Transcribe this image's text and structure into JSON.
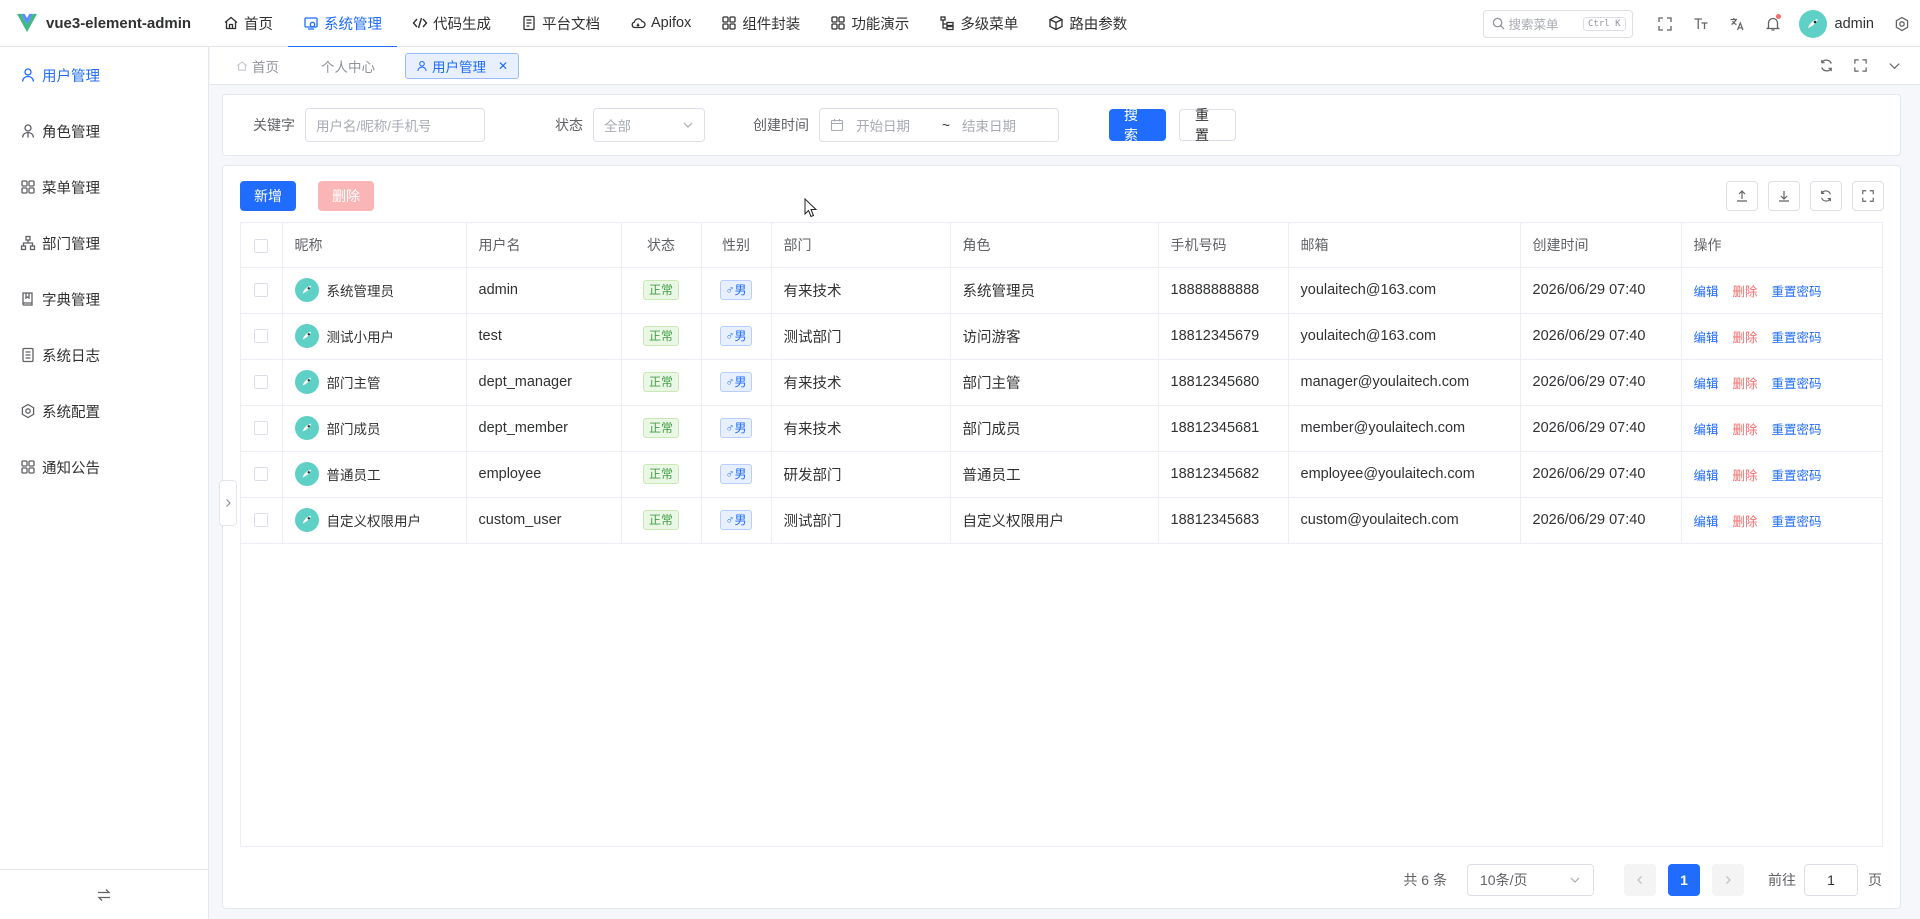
{
  "app": {
    "title": "vue3-element-admin",
    "brand_color": "#1f6cff"
  },
  "top_menu": [
    {
      "label": "首页",
      "icon": "home-icon",
      "active": false
    },
    {
      "label": "系统管理",
      "icon": "system-icon",
      "active": true
    },
    {
      "label": "代码生成",
      "icon": "code-icon",
      "active": false
    },
    {
      "label": "平台文档",
      "icon": "document-icon",
      "active": false
    },
    {
      "label": "Apifox",
      "icon": "cloud-icon",
      "active": false
    },
    {
      "label": "组件封装",
      "icon": "grid-icon",
      "active": false
    },
    {
      "label": "功能演示",
      "icon": "grid-icon",
      "active": false
    },
    {
      "label": "多级菜单",
      "icon": "tree-icon",
      "active": false
    },
    {
      "label": "路由参数",
      "icon": "cube-icon",
      "active": false
    }
  ],
  "header": {
    "search_placeholder": "搜索菜单",
    "search_shortcut": "Ctrl K",
    "user_name": "admin"
  },
  "sidebar": {
    "items": [
      {
        "label": "用户管理",
        "icon": "user-icon",
        "active": true
      },
      {
        "label": "角色管理",
        "icon": "role-icon",
        "active": false
      },
      {
        "label": "菜单管理",
        "icon": "menu-grid-icon",
        "active": false
      },
      {
        "label": "部门管理",
        "icon": "org-icon",
        "active": false
      },
      {
        "label": "字典管理",
        "icon": "book-icon",
        "active": false
      },
      {
        "label": "系统日志",
        "icon": "log-icon",
        "active": false
      },
      {
        "label": "系统配置",
        "icon": "settings-icon",
        "active": false
      },
      {
        "label": "通知公告",
        "icon": "notice-grid-icon",
        "active": false
      }
    ]
  },
  "tags": [
    {
      "label": "首页",
      "active": false
    },
    {
      "label": "个人中心",
      "active": false
    },
    {
      "label": "用户管理",
      "active": true
    }
  ],
  "filters": {
    "keyword_label": "关键字",
    "keyword_placeholder": "用户名/昵称/手机号",
    "status_label": "状态",
    "status_value": "全部",
    "created_label": "创建时间",
    "start_placeholder": "开始日期",
    "range_sep": "~",
    "end_placeholder": "结束日期",
    "search_button": "搜索",
    "reset_button": "重置"
  },
  "toolbar": {
    "add_button": "新增",
    "delete_button": "删除"
  },
  "table": {
    "columns": [
      "昵称",
      "用户名",
      "状态",
      "性别",
      "部门",
      "角色",
      "手机号码",
      "邮箱",
      "创建时间",
      "操作"
    ],
    "rows": [
      {
        "nickname": "系统管理员",
        "username": "admin",
        "status": "正常",
        "gender": "♂男",
        "dept": "有来技术",
        "role": "系统管理员",
        "mobile": "18888888888",
        "email": "youlaitech@163.com",
        "created": "2026/06/29 07:40"
      },
      {
        "nickname": "测试小用户",
        "username": "test",
        "status": "正常",
        "gender": "♂男",
        "dept": "测试部门",
        "role": "访问游客",
        "mobile": "18812345679",
        "email": "youlaitech@163.com",
        "created": "2026/06/29 07:40"
      },
      {
        "nickname": "部门主管",
        "username": "dept_manager",
        "status": "正常",
        "gender": "♂男",
        "dept": "有来技术",
        "role": "部门主管",
        "mobile": "18812345680",
        "email": "manager@youlaitech.com",
        "created": "2026/06/29 07:40"
      },
      {
        "nickname": "部门成员",
        "username": "dept_member",
        "status": "正常",
        "gender": "♂男",
        "dept": "有来技术",
        "role": "部门成员",
        "mobile": "18812345681",
        "email": "member@youlaitech.com",
        "created": "2026/06/29 07:40"
      },
      {
        "nickname": "普通员工",
        "username": "employee",
        "status": "正常",
        "gender": "♂男",
        "dept": "研发部门",
        "role": "普通员工",
        "mobile": "18812345682",
        "email": "employee@youlaitech.com",
        "created": "2026/06/29 07:40"
      },
      {
        "nickname": "自定义权限用户",
        "username": "custom_user",
        "status": "正常",
        "gender": "♂男",
        "dept": "测试部门",
        "role": "自定义权限用户",
        "mobile": "18812345683",
        "email": "custom@youlaitech.com",
        "created": "2026/06/29 07:40"
      }
    ],
    "row_actions": {
      "edit": "编辑",
      "delete": "删除",
      "reset_password": "重置密码"
    }
  },
  "pagination": {
    "total": "共 6 条",
    "page_size": "10条/页",
    "current_page": "1",
    "goto_label": "前往",
    "goto_value": "1",
    "page_suffix": "页"
  }
}
